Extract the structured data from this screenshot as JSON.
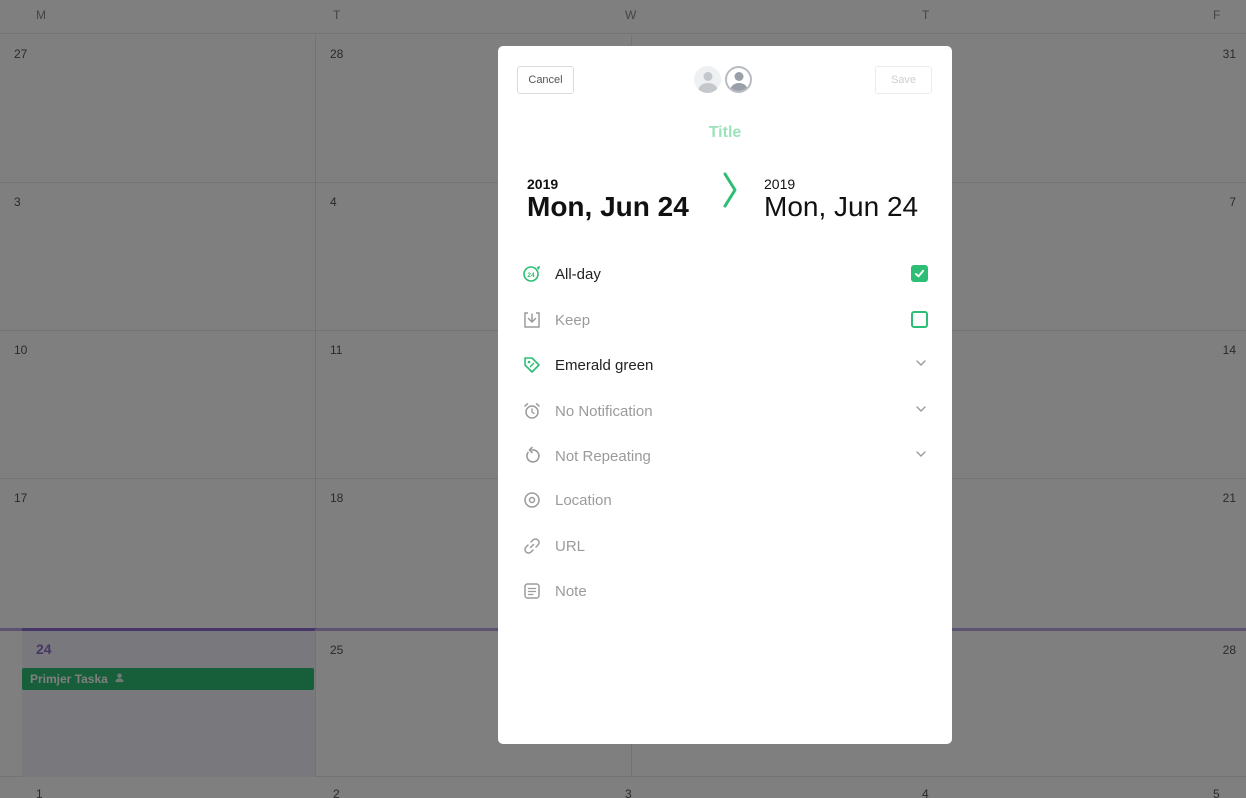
{
  "calendar": {
    "weekdays": [
      "M",
      "T",
      "W",
      "T",
      "F"
    ],
    "weeks": [
      [
        "27",
        "28",
        "31"
      ],
      [
        "3",
        "4",
        "7"
      ],
      [
        "10",
        "11",
        "14"
      ],
      [
        "17",
        "18",
        "21"
      ],
      [
        "24",
        "25",
        "28"
      ],
      [
        "1",
        "2",
        "3",
        "4",
        "5"
      ]
    ],
    "event": {
      "label": "Primjer Taska",
      "color": "#2ebd74"
    },
    "today_color": "#8e6ccf"
  },
  "modal": {
    "cancel_label": "Cancel",
    "save_label": "Save",
    "title_placeholder": "Title",
    "start": {
      "year": "2019",
      "date": "Mon, Jun 24"
    },
    "end": {
      "year": "2019",
      "date": "Mon, Jun 24"
    },
    "accent": "#2ebd74",
    "options": [
      {
        "label": "All-day",
        "icon": "24h-icon",
        "control": "checkbox",
        "checked": true
      },
      {
        "label": "Keep",
        "icon": "keep-download-icon",
        "control": "checkbox",
        "checked": false
      },
      {
        "label": "Emerald green",
        "icon": "tag-icon",
        "control": "dropdown"
      },
      {
        "label": "No Notification",
        "icon": "alarm-clock-icon",
        "control": "dropdown"
      },
      {
        "label": "Not Repeating",
        "icon": "repeat-icon",
        "control": "dropdown"
      },
      {
        "label": "Location",
        "icon": "location-pin-icon"
      },
      {
        "label": "URL",
        "icon": "link-icon"
      },
      {
        "label": "Note",
        "icon": "note-icon"
      }
    ]
  }
}
